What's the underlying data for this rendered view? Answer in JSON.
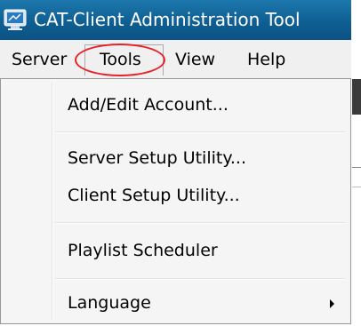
{
  "window": {
    "title": "CAT-Client Administration Tool",
    "titlebar_color": "#1570a6",
    "app_icon": "computer-monitor-icon"
  },
  "menubar": {
    "items": [
      {
        "label": "Server"
      },
      {
        "label": "Tools",
        "active": true
      },
      {
        "label": "View"
      },
      {
        "label": "Help"
      }
    ],
    "highlight_color": "#e8202a"
  },
  "tools_menu": {
    "items": [
      {
        "label": "Add/Edit Account..."
      },
      {
        "label": "Server Setup Utility..."
      },
      {
        "label": "Client Setup Utility..."
      },
      {
        "label": "Playlist Scheduler"
      },
      {
        "label": "Language",
        "submenu_icon": "chevron-right-icon"
      }
    ]
  }
}
